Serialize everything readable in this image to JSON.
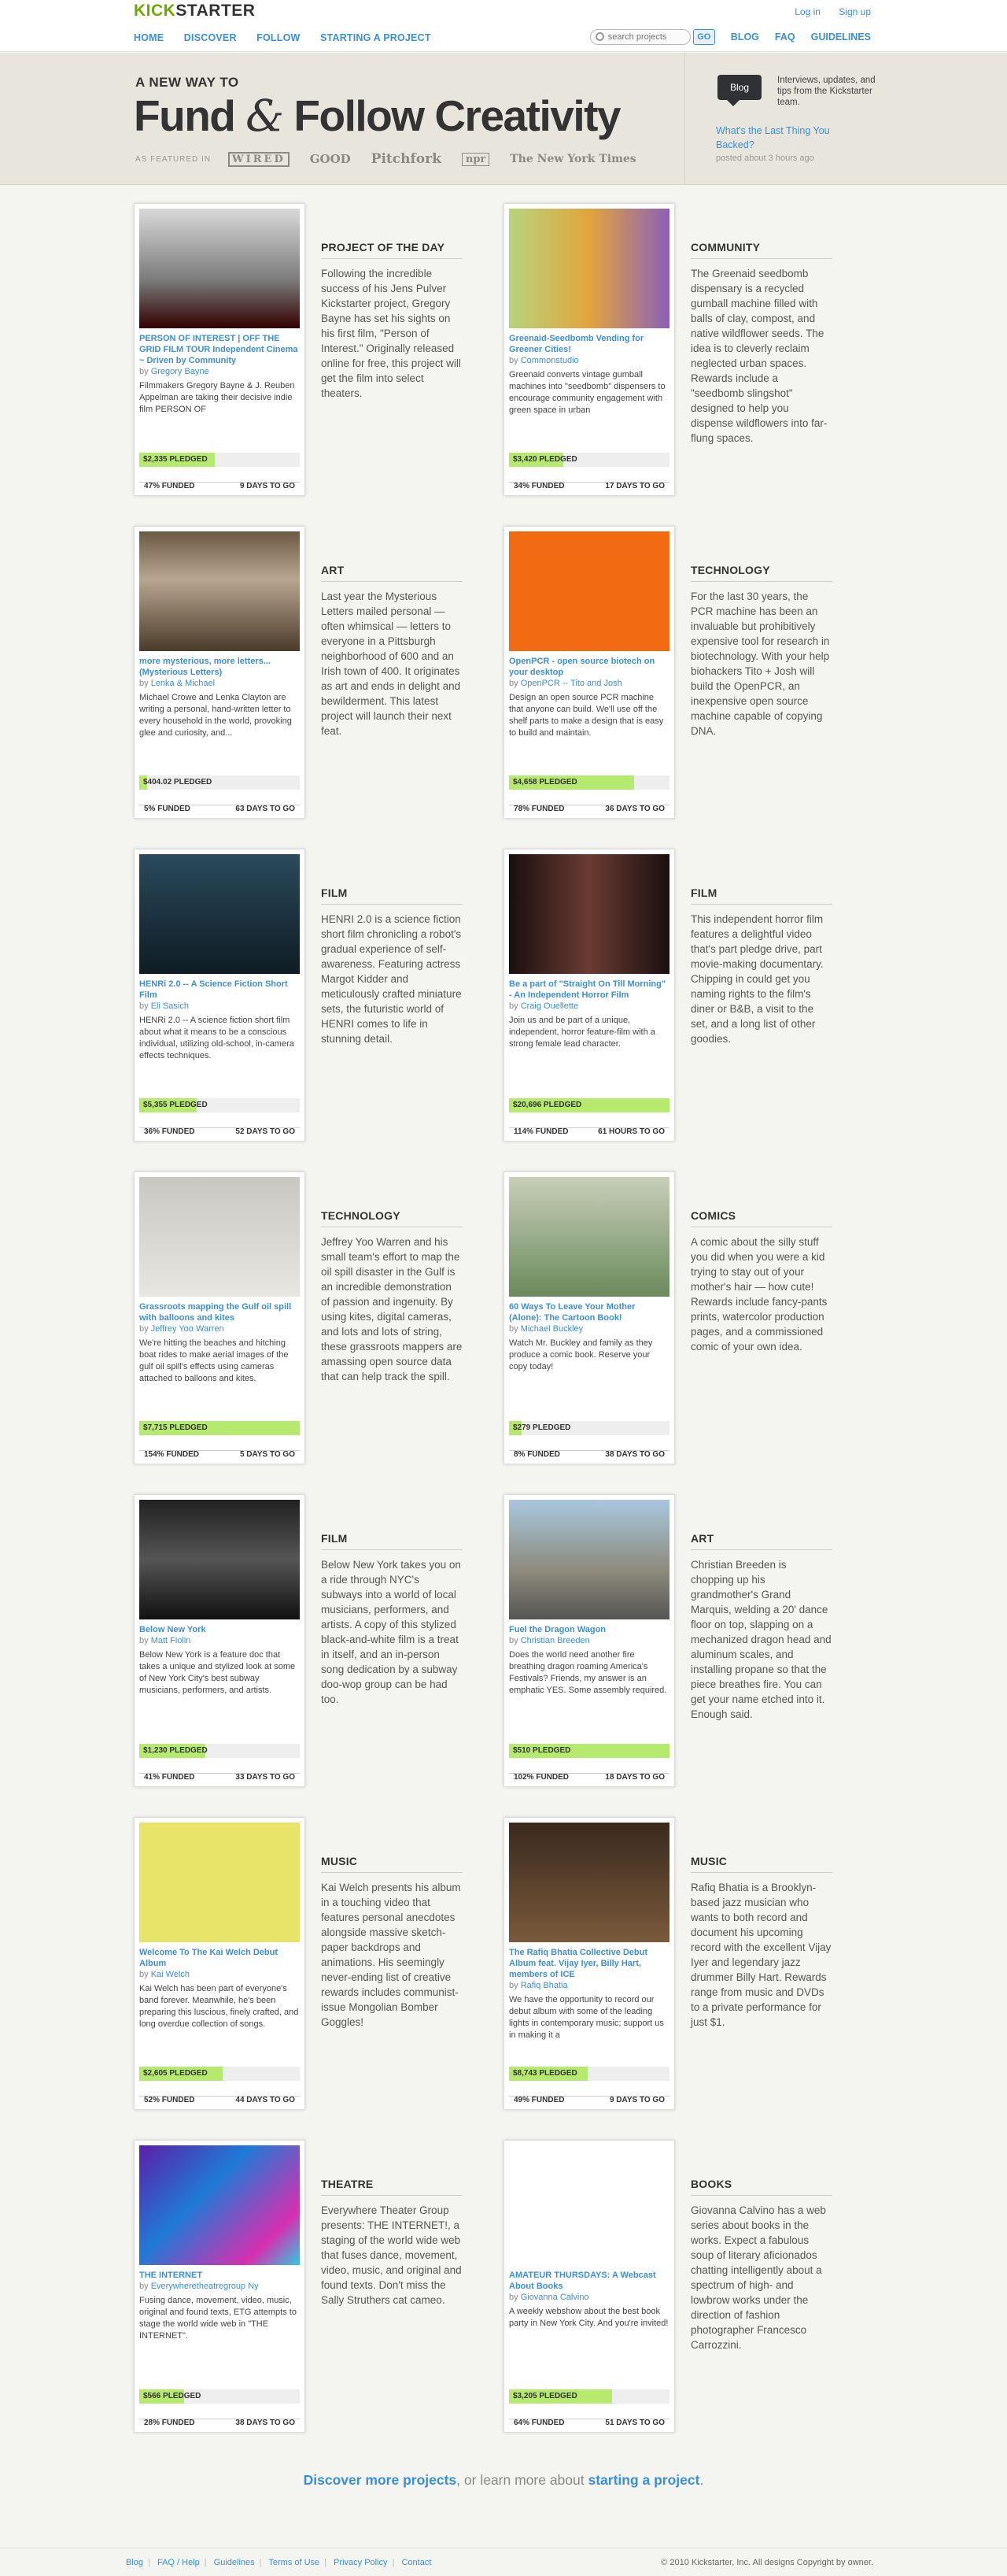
{
  "logo": {
    "kick": "KICK",
    "starter": "STARTER"
  },
  "top_links": {
    "login": "Log in",
    "signup": "Sign up"
  },
  "nav": {
    "home": "HOME",
    "discover": "DISCOVER",
    "follow": "FOLLOW",
    "start": "STARTING A PROJECT",
    "search_placeholder": "search projects",
    "go": "GO",
    "blog": "BLOG",
    "faq": "FAQ",
    "guidelines": "GUIDELINES"
  },
  "hero": {
    "tagline": "A NEW WAY TO",
    "headline_a": "Fund ",
    "amp": "&",
    "headline_b": " Follow Creativity",
    "featured_label": "AS FEATURED IN",
    "pubs": [
      "WIRED",
      "GOOD",
      "Pitchfork",
      "npr",
      "The New York Times"
    ],
    "blog_label": "Blog",
    "blog_desc": "Interviews, updates, and tips from the Kickstarter team.",
    "blog_post": "What's the Last Thing You Backed?",
    "blog_time": "posted about 3 hours ago"
  },
  "colors": {
    "accent": "#3b8fd6",
    "funded": "#b5ea6f",
    "brand": "#6ea800"
  },
  "rows": [
    {
      "left": {
        "card": {
          "title": "PERSON OF INTEREST | OFF THE GRID FILM TOUR Independent Cinema ~ Driven by Community",
          "by": "Gregory Bayne",
          "desc": "Filmmakers Gregory Bayne & J. Reuben Appelman are taking their decisive indie film PERSON OF",
          "pledged": "$2,335 PLEDGED",
          "funded": "47% FUNDED",
          "togo": "9 DAYS TO GO",
          "pct": 0.47
        },
        "cat": {
          "name": "PROJECT OF THE DAY",
          "text": "Following the incredible success of his Jens Pulver Kickstarter project, Gregory Bayne has set his sights on his first film, \"Person of Interest.\" Originally released online for free, this project will get the film into select theaters."
        }
      },
      "right": {
        "card": {
          "title": "Greenaid-Seedbomb Vending for Greener Cities!",
          "by": "Commonstudio",
          "desc": "Greenaid converts vintage gumball machines into \"seedbomb\" dispensers to encourage community engagement with green space in urban",
          "pledged": "$3,420 PLEDGED",
          "funded": "34% FUNDED",
          "togo": "17 DAYS TO GO",
          "pct": 0.34
        },
        "cat": {
          "name": "COMMUNITY",
          "text": "The Greenaid seedbomb dispensary is a recycled gumball machine filled with balls of clay, compost, and native wildflower seeds. The idea is to cleverly reclaim neglected urban spaces. Rewards include a \"seedbomb slingshot\" designed to help you dispense wildflowers into far-flung spaces."
        }
      }
    },
    {
      "left": {
        "card": {
          "title": "more mysterious, more letters... (Mysterious Letters)",
          "by": "Lenka & Michael",
          "desc": "Michael Crowe and Lenka Clayton are writing a personal, hand-written letter to every household in the world, provoking glee and curiosity, and...",
          "pledged": "$404.02 PLEDGED",
          "funded": "5% FUNDED",
          "togo": "63 DAYS TO GO",
          "pct": 0.05
        },
        "cat": {
          "name": "ART",
          "text": "Last year the Mysterious Letters mailed personal — often whimsical — letters to everyone in a Pittsburgh neighborhood of 600 and an Irish town of 400. It originates as art and ends in delight and bewilderment. This latest project will launch their next feat."
        }
      },
      "right": {
        "card": {
          "title": "OpenPCR - open source biotech on your desktop",
          "by": "OpenPCR -- Tito and Josh",
          "desc": "Design an open source PCR machine that anyone can build. We'll use off the shelf parts to make a design that is easy to build and maintain.",
          "pledged": "$4,658 PLEDGED",
          "funded": "78% FUNDED",
          "togo": "36 DAYS TO GO",
          "pct": 0.78
        },
        "cat": {
          "name": "TECHNOLOGY",
          "text": "For the last 30 years, the PCR machine has been an invaluable but prohibitively expensive tool for research in biotechnology. With your help biohackers Tito + Josh will build the OpenPCR, an inexpensive open source machine capable of copying DNA."
        }
      }
    },
    {
      "left": {
        "card": {
          "title": "HENRi 2.0 -- A Science Fiction Short Film",
          "by": "Eli Sasich",
          "desc": "HENRi 2.0 -- A science fiction short film about what it means to be a conscious individual, utilizing old-school, in-camera effects techniques.",
          "pledged": "$5,355 PLEDGED",
          "funded": "36% FUNDED",
          "togo": "52 DAYS TO GO",
          "pct": 0.36
        },
        "cat": {
          "name": "FILM",
          "text": "HENRI 2.0 is a science fiction short film chronicling a robot's gradual experience of self-awareness. Featuring actress Margot Kidder and meticulously crafted miniature sets, the futuristic world of HENRI comes to life in stunning detail."
        }
      },
      "right": {
        "card": {
          "title": "Be a part of \"Straight On Till Morning\" - An Independent Horror Film",
          "by": "Craig Ouellette",
          "desc": "Join us and be part of a unique, independent, horror feature-film with a strong female lead character.",
          "pledged": "$20,696 PLEDGED",
          "funded": "114% FUNDED",
          "togo": "61 HOURS TO GO",
          "pct": 1.0
        },
        "cat": {
          "name": "FILM",
          "text": "This independent horror film features a delightful video that's part pledge drive, part movie-making documentary. Chipping in could get you naming rights to the film's diner or B&B, a visit to the set, and a long list of other goodies."
        }
      }
    },
    {
      "left": {
        "card": {
          "title": "Grassroots mapping the Gulf oil spill with balloons and kites",
          "by": "Jeffrey Yoo Warren",
          "desc": "We're hitting the beaches and hitching boat rides to make aerial images of the gulf oil spill's effects using cameras attached to balloons and kites.",
          "pledged": "$7,715 PLEDGED",
          "funded": "154% FUNDED",
          "togo": "5 DAYS TO GO",
          "pct": 1.0
        },
        "cat": {
          "name": "TECHNOLOGY",
          "text": "Jeffrey Yoo Warren and his small team's effort to map the oil spill disaster in the Gulf is an incredible demonstration of passion and ingenuity. By using kites, digital cameras, and lots and lots of string, these grassroots mappers are amassing open source data that can help track the spill."
        }
      },
      "right": {
        "card": {
          "title": "60 Ways To Leave Your Mother (Alone): The Cartoon Book!",
          "by": "Michael Buckley",
          "desc": "Watch Mr. Buckley and family as they produce a comic book. Reserve your copy today!",
          "pledged": "$279 PLEDGED",
          "funded": "8% FUNDED",
          "togo": "38 DAYS TO GO",
          "pct": 0.08
        },
        "cat": {
          "name": "COMICS",
          "text": "A comic about the silly stuff you did when you were a kid trying to stay out of your mother's hair — how cute! Rewards include fancy-pants prints, watercolor production pages, and a commissioned comic of your own idea."
        }
      }
    },
    {
      "left": {
        "card": {
          "title": "Below New York",
          "by": "Matt Fiolin",
          "desc": "Below New York is a feature doc that takes a unique and stylized look at some of New York City's best subway musicians, performers, and artists.",
          "pledged": "$1,230 PLEDGED",
          "funded": "41% FUNDED",
          "togo": "33 DAYS TO GO",
          "pct": 0.41
        },
        "cat": {
          "name": "FILM",
          "text": "Below New York takes you on a ride through NYC's subways into a world of local musicians, performers, and artists. A copy of this stylized black-and-white film is a treat in itself, and an in-person song dedication by a subway doo-wop group can be had too."
        }
      },
      "right": {
        "card": {
          "title": "Fuel the Dragon Wagon",
          "by": "Christian Breeden",
          "desc": "Does the world need another fire breathing dragon roaming America's Festivals? Friends, my answer is an emphatic YES. Some assembly required.",
          "pledged": "$510 PLEDGED",
          "funded": "102% FUNDED",
          "togo": "18 DAYS TO GO",
          "pct": 1.0
        },
        "cat": {
          "name": "ART",
          "text": "Christian Breeden is chopping up his grandmother's Grand Marquis, welding a 20' dance floor on top, slapping on a mechanized dragon head and aluminum scales, and installing propane so that the piece breathes fire. You can get your name etched into it. Enough said."
        }
      }
    },
    {
      "left": {
        "card": {
          "title": "Welcome To The Kai Welch Debut Album",
          "by": "Kai Welch",
          "desc": "Kai Welch has been part of everyone's band forever. Meanwhile, he's been preparing this luscious, finely crafted, and long overdue collection of songs.",
          "pledged": "$2,605 PLEDGED",
          "funded": "52% FUNDED",
          "togo": "44 DAYS TO GO",
          "pct": 0.52
        },
        "cat": {
          "name": "MUSIC",
          "text": "Kai Welch presents his album in a touching video that features personal anecdotes alongside massive sketch-paper backdrops and animations. His seemingly never-ending list of creative rewards includes communist-issue Mongolian Bomber Goggles!"
        }
      },
      "right": {
        "card": {
          "title": "The Rafiq Bhatia Collective Debut Album feat. Vijay Iyer, Billy Hart, members of ICE",
          "by": "Rafiq Bhatia",
          "desc": "We have the opportunity to record our debut album with some of the leading lights in contemporary music; support us in making it a",
          "pledged": "$8,743 PLEDGED",
          "funded": "49% FUNDED",
          "togo": "9 DAYS TO GO",
          "pct": 0.49
        },
        "cat": {
          "name": "MUSIC",
          "text": "Rafiq Bhatia is a Brooklyn-based jazz musician who wants to both record and document his upcoming record with the excellent Vijay Iyer and legendary jazz drummer Billy Hart. Rewards range from music and DVDs to a private performance for just $1."
        }
      }
    },
    {
      "left": {
        "card": {
          "title": "THE INTERNET",
          "by": "Everywheretheatregroup Ny",
          "desc": "Fusing dance, movement, video, music, original and found texts, ETG attempts to stage the world wide web in \"THE INTERNET\".",
          "pledged": "$566 PLEDGED",
          "funded": "28% FUNDED",
          "togo": "38 DAYS TO GO",
          "pct": 0.28
        },
        "cat": {
          "name": "THEATRE",
          "text": "Everywhere Theater Group presents: THE INTERNET!, a staging of the world wide web that fuses dance, movement, video, music, and original and found texts. Don't miss the Sally Struthers cat cameo."
        }
      },
      "right": {
        "card": {
          "title": "AMATEUR THURSDAYS: A Webcast About Books",
          "by": "Giovanna Calvino",
          "desc": "A weekly webshow about the best book party in New York City. And you're invited!",
          "pledged": "$3,205 PLEDGED",
          "funded": "64% FUNDED",
          "togo": "51 DAYS TO GO",
          "pct": 0.64
        },
        "cat": {
          "name": "BOOKS",
          "text": "Giovanna Calvino has a web series about books in the works. Expect a fabulous soup of literary aficionados chatting intelligently about a spectrum of high- and lowbrow works under the direction of fashion photographer Francesco Carrozzini."
        }
      }
    }
  ],
  "by_prefix": "by ",
  "discover": {
    "link1": "Discover more projects",
    "mid": ", or learn more about ",
    "link2": "starting a project",
    "end": "."
  },
  "footer": {
    "links": [
      "Blog",
      "FAQ / Help",
      "Guidelines",
      "Terms of Use",
      "Privacy Policy",
      "Contact"
    ],
    "copyright": "© 2010 Kickstarter, Inc. All designs Copyright by owner."
  }
}
